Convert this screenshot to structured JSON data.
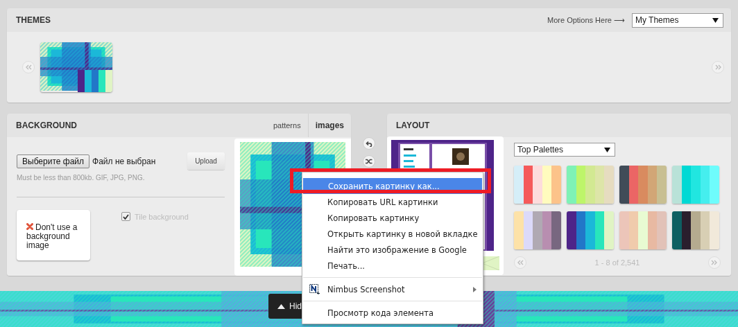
{
  "themes": {
    "title": "THEMES",
    "more_options": "More Options Here ⟶",
    "select": {
      "value": "My Themes"
    },
    "items": [
      {
        "kind": "picture",
        "swatches": [
          {
            "color": "#4e2489"
          },
          {
            "color": "#1bb8d8"
          },
          {
            "color": "#2277c8"
          },
          {
            "color": "#28e6bb"
          },
          {
            "color": "#e0f4c4"
          }
        ]
      }
    ]
  },
  "background": {
    "title": "BACKGROUND",
    "tabs": [
      {
        "label": "patterns",
        "selected": false
      },
      {
        "label": "images",
        "selected": true
      }
    ],
    "file_button": "Выберите файл",
    "file_status": "Файл не выбран",
    "upload_button": "Upload",
    "hint": "Must be less than 800kb. GIF, JPG, PNG.",
    "no_image_button": "Don't use a background image",
    "tile": {
      "label": "Tile background",
      "checked": true
    }
  },
  "layout": {
    "title": "LAYOUT",
    "palette_select": {
      "value": "Top Palettes"
    },
    "palettes": [
      {
        "swatches": [
          {
            "color": "#d5eef8"
          },
          {
            "color": "#f55a5a"
          },
          {
            "color": "#fddcdc"
          },
          {
            "color": "#fffbbe"
          },
          {
            "color": "#fcc38a"
          }
        ]
      },
      {
        "swatches": [
          {
            "color": "#7ef2b6"
          },
          {
            "color": "#bdf56a"
          },
          {
            "color": "#d2e992"
          },
          {
            "color": "#dde5a8"
          },
          {
            "color": "#e6dcc0"
          }
        ]
      },
      {
        "swatches": [
          {
            "color": "#404c58"
          },
          {
            "color": "#eb6565"
          },
          {
            "color": "#d98b5f"
          },
          {
            "color": "#d2a676"
          },
          {
            "color": "#c8bf92"
          }
        ]
      },
      {
        "swatches": [
          {
            "color": "#b9e2d8"
          },
          {
            "color": "#00d9d4"
          },
          {
            "color": "#21e6e0"
          },
          {
            "color": "#45eeee"
          },
          {
            "color": "#6efcfc"
          }
        ]
      },
      {
        "swatches": [
          {
            "color": "#fde2a8"
          },
          {
            "color": "#dcdafa"
          },
          {
            "color": "#b0a9b3"
          },
          {
            "color": "#b88eb0"
          },
          {
            "color": "#786780"
          }
        ]
      },
      {
        "swatches": [
          {
            "color": "#4e2489"
          },
          {
            "color": "#2277c8"
          },
          {
            "color": "#1bb8d8"
          },
          {
            "color": "#28e6bb"
          },
          {
            "color": "#e0f4c4"
          }
        ]
      },
      {
        "swatches": [
          {
            "color": "#ecc5b9"
          },
          {
            "color": "#f0cbac"
          },
          {
            "color": "#e8fbd2"
          },
          {
            "color": "#e8b9a2"
          },
          {
            "color": "#e2c2b8"
          }
        ]
      },
      {
        "swatches": [
          {
            "color": "#0e5f62"
          },
          {
            "color": "#2a1f2d"
          },
          {
            "color": "#b5ab8f"
          },
          {
            "color": "#d8cfb4"
          },
          {
            "color": "#f1e9da"
          }
        ]
      }
    ],
    "pager": "1 - 8 of 2,541"
  },
  "bottom_bar": {
    "hide_button": "Hid"
  },
  "context_menu": {
    "groups": [
      [
        {
          "label": "Сохранить картинку как...",
          "highlighted": true,
          "submenu": false
        },
        {
          "label": "Копировать URL картинки",
          "highlighted": false,
          "submenu": false
        },
        {
          "label": "Копировать картинку",
          "highlighted": false,
          "submenu": false
        },
        {
          "label": "Открыть картинку в новой вкладке",
          "highlighted": false,
          "submenu": false
        },
        {
          "label": "Найти это изображение в Google",
          "highlighted": false,
          "submenu": false
        },
        {
          "label": "Печать...",
          "highlighted": false,
          "submenu": false
        }
      ],
      [
        {
          "label": "Nimbus Screenshot",
          "highlighted": false,
          "submenu": true,
          "icon": true
        }
      ],
      [
        {
          "label": "Просмотр кода элемента",
          "highlighted": false,
          "submenu": false
        }
      ]
    ]
  }
}
